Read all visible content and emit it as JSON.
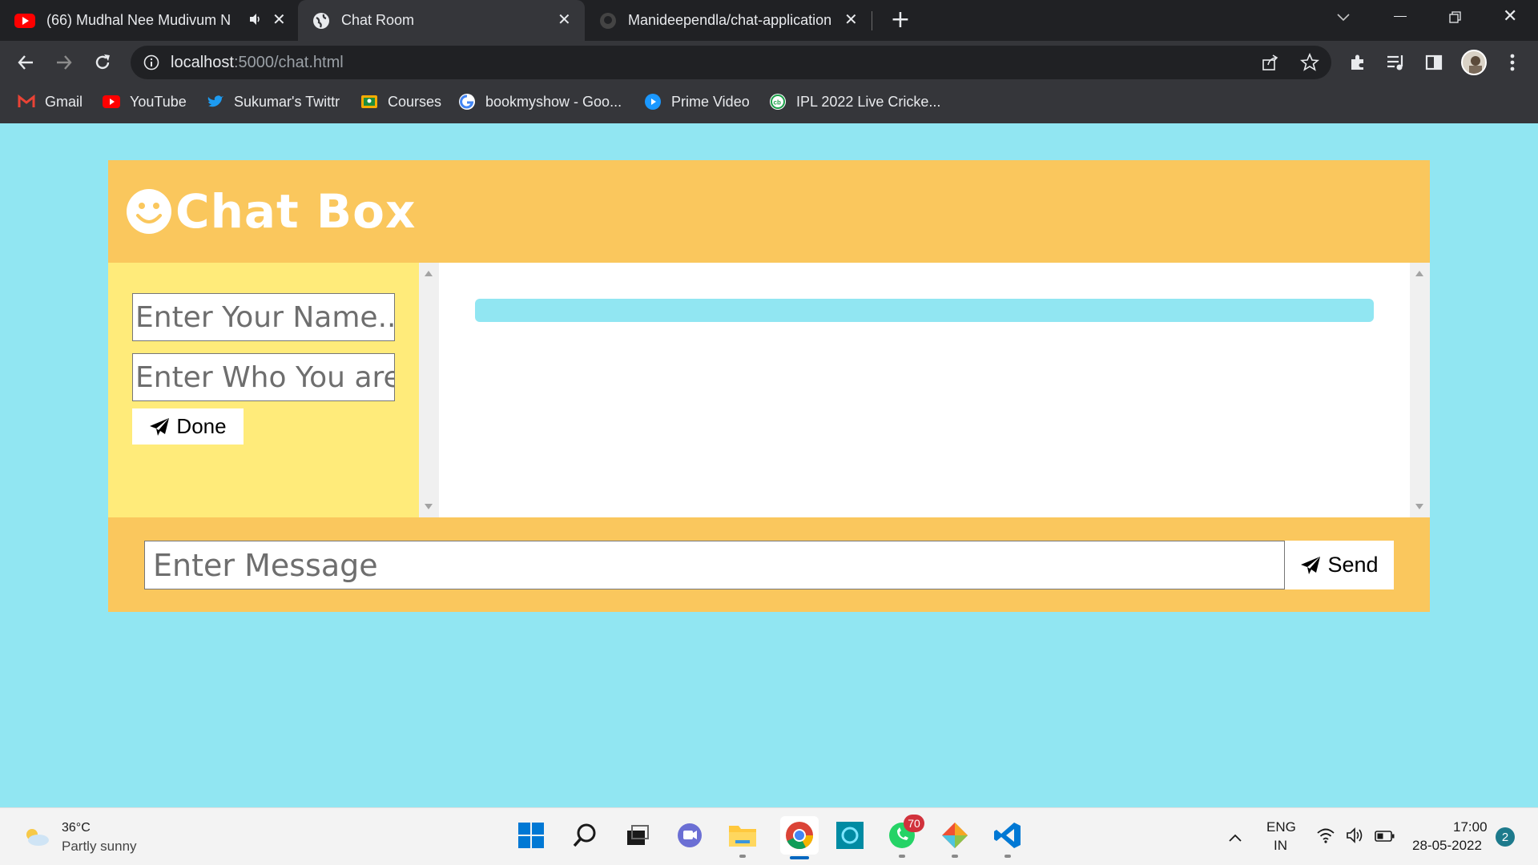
{
  "browser": {
    "tabs": [
      {
        "title": "(66) Mudhal Nee Mudivum N",
        "favicon": "youtube-icon",
        "active": false
      },
      {
        "title": "Chat Room",
        "favicon": "globe-icon",
        "active": true
      },
      {
        "title": "Manideependla/chat-application",
        "favicon": "github-icon",
        "active": false
      }
    ],
    "url": {
      "host": "localhost",
      "path": ":5000/chat.html"
    },
    "bookmarks": [
      {
        "label": "Gmail",
        "icon": "gmail-icon"
      },
      {
        "label": "YouTube",
        "icon": "youtube-icon"
      },
      {
        "label": "Sukumar's Twittr",
        "icon": "twitter-icon"
      },
      {
        "label": "Courses",
        "icon": "classroom-icon"
      },
      {
        "label": "bookmyshow - Goo...",
        "icon": "google-icon"
      },
      {
        "label": "Prime Video",
        "icon": "prime-video-icon"
      },
      {
        "label": "IPL 2022 Live Cricke...",
        "icon": "cricbuzz-icon"
      }
    ]
  },
  "page": {
    "title": "Chat Box",
    "name_placeholder": "Enter Your Name..",
    "who_placeholder": "Enter Who You are",
    "done_label": "Done",
    "message_placeholder": "Enter Message",
    "send_label": "Send"
  },
  "taskbar": {
    "weather": {
      "temp": "36°C",
      "condition": "Partly sunny"
    },
    "language": {
      "line1": "ENG",
      "line2": "IN"
    },
    "time": "17:00",
    "date": "28-05-2022",
    "whatsapp_badge": "70",
    "notification_count": "2"
  },
  "colors": {
    "page_background": "#91e6f2",
    "header_background": "#fac75d",
    "sidebar_background": "#ffeb7a"
  }
}
